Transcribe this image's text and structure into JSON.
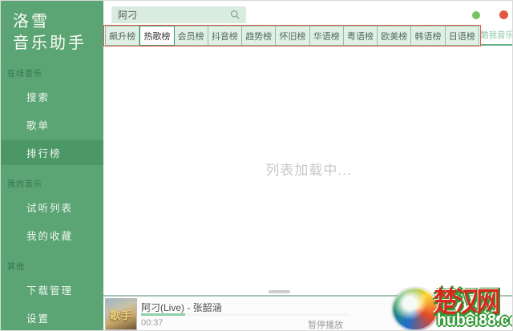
{
  "window": {
    "minimize_color": "#77c35e",
    "close_color": "#e2593f"
  },
  "sidebar": {
    "logo_line1": "洛雪",
    "logo_line2": "音乐助手",
    "sections": [
      {
        "label": "在线音乐",
        "key": "online-music",
        "items": [
          {
            "label": "搜索",
            "key": "search",
            "active": false
          },
          {
            "label": "歌单",
            "key": "songlist",
            "active": false
          },
          {
            "label": "排行榜",
            "key": "ranking",
            "active": true
          }
        ]
      },
      {
        "label": "我的音乐",
        "key": "my-music",
        "items": [
          {
            "label": "试听列表",
            "key": "listen-list",
            "active": false
          },
          {
            "label": "我的收藏",
            "key": "my-collection",
            "active": false
          }
        ]
      },
      {
        "label": "其他",
        "key": "other",
        "items": [
          {
            "label": "下载管理",
            "key": "download-manager",
            "active": false
          },
          {
            "label": "设置",
            "key": "settings",
            "active": false
          }
        ]
      }
    ]
  },
  "header": {
    "search_value": "阿刁"
  },
  "tabs": {
    "active": "热歌榜",
    "items": [
      {
        "label": "飙升榜",
        "key": "soaring"
      },
      {
        "label": "热歌榜",
        "key": "hot-songs"
      },
      {
        "label": "会员榜",
        "key": "vip"
      },
      {
        "label": "抖音榜",
        "key": "douyin"
      },
      {
        "label": "趋势榜",
        "key": "trend"
      },
      {
        "label": "怀旧榜",
        "key": "nostalgia"
      },
      {
        "label": "华语榜",
        "key": "chinese"
      },
      {
        "label": "粤语榜",
        "key": "cantonese"
      },
      {
        "label": "欧美榜",
        "key": "western"
      },
      {
        "label": "韩语榜",
        "key": "korean"
      },
      {
        "label": "日语榜",
        "key": "japanese"
      }
    ],
    "source": "酷我音乐"
  },
  "main": {
    "loading_text": "列表加载中..."
  },
  "player": {
    "album_art_text": "歌手",
    "song_title": "阿刁(Live) - 张韶涵",
    "elapsed_time": "00:37",
    "status_text": "暂停播放",
    "progress_pct": 21
  },
  "watermark": {
    "site_name": "楚汉网",
    "site_url": "hubei88.com"
  },
  "colors": {
    "sidebar_green": "#5ba474",
    "sidebar_active": "#4c9766",
    "tab_bg": "#e1f0e7",
    "tab_border": "#8cbf9f",
    "annotation_red": "#dd5a52",
    "min_color": "#77c35e",
    "close_color": "#e2593f",
    "watermark_red": "#d42a1d",
    "watermark_green": "#2f9631"
  }
}
